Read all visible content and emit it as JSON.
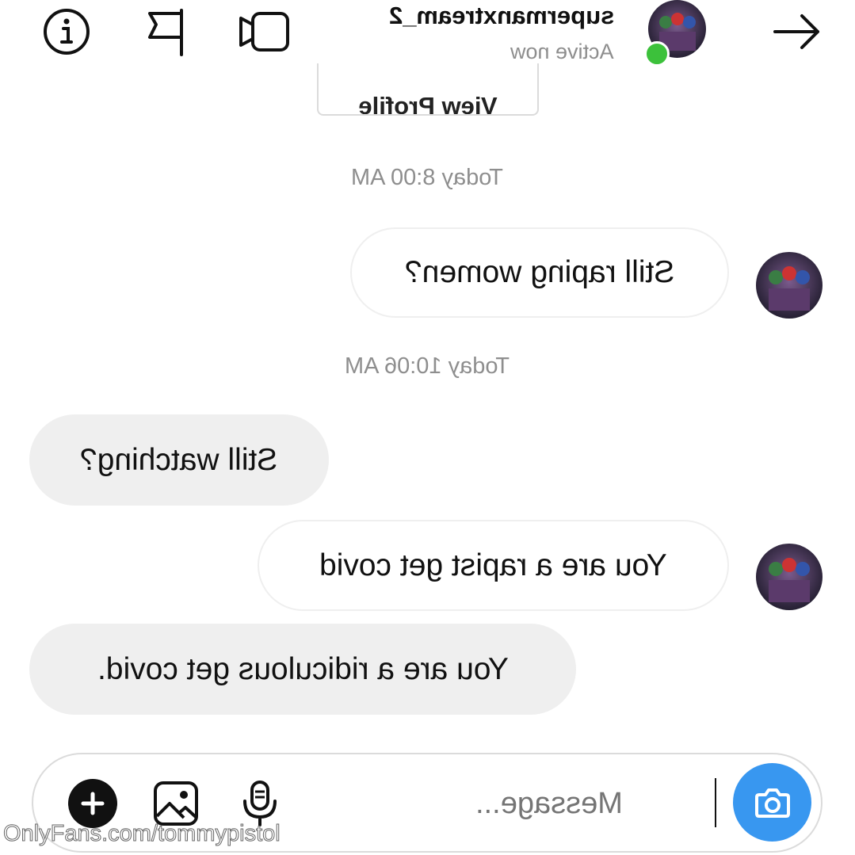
{
  "header": {
    "username": "supermanxtream_2",
    "status": "Active now",
    "icons": {
      "info": "info-icon",
      "report": "flag-icon",
      "video": "video-call-icon",
      "forward": "arrow-right-icon"
    }
  },
  "thread": {
    "view_profile_label": "View Profile",
    "timestamp_1": "Today 8:00 AM",
    "timestamp_2": "Today 10:06 AM",
    "messages": [
      {
        "from": "other",
        "text": "Still raping women?"
      },
      {
        "from": "me",
        "text": "Still watching?"
      },
      {
        "from": "other",
        "text": "You are a rapist get covid"
      },
      {
        "from": "me",
        "text": "You are a ridiculous get covid."
      }
    ]
  },
  "composer": {
    "placeholder": "Message...",
    "value": "",
    "icons": [
      "camera-icon",
      "microphone-icon",
      "image-icon",
      "add-icon"
    ]
  },
  "watermark": "OnlyFans.com/tommypistol",
  "colors": {
    "accent": "#3897f0",
    "online": "#3cc13b",
    "received_bubble": "#efefef",
    "muted_text": "#8e8e8e"
  }
}
